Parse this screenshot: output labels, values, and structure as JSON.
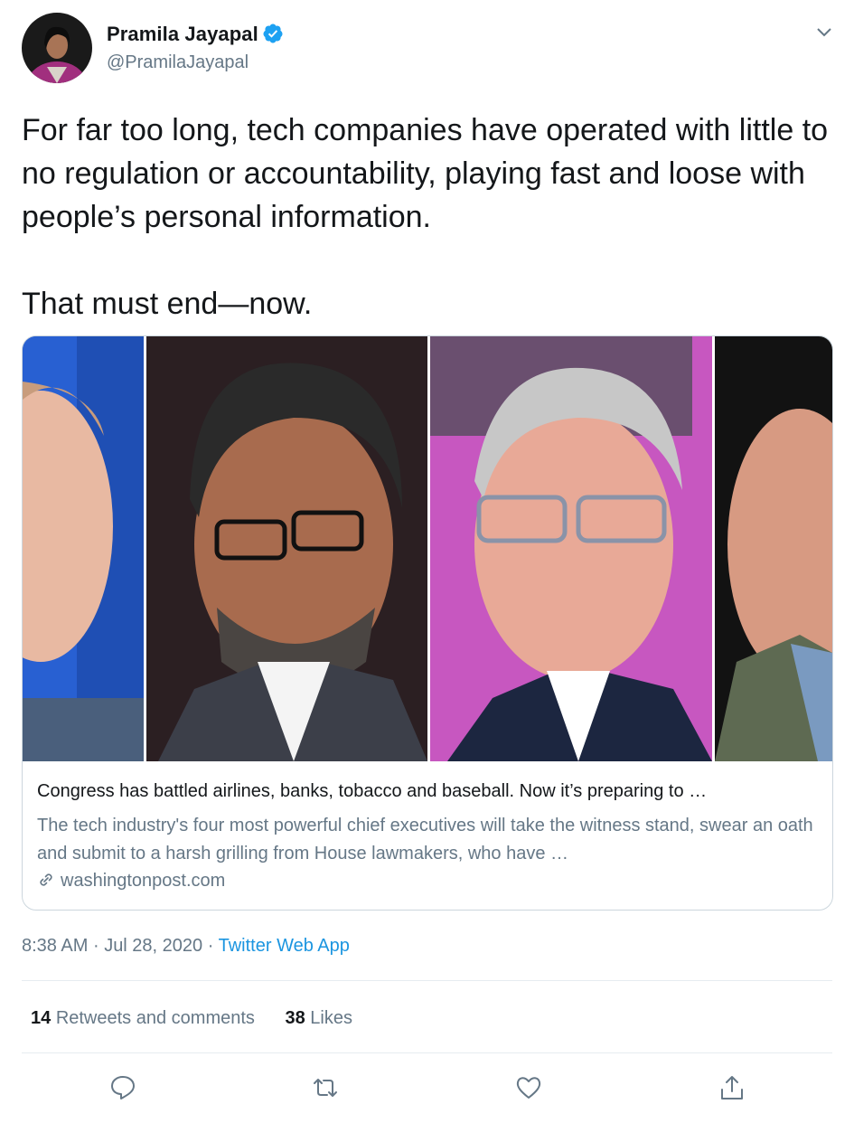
{
  "author": {
    "name": "Pramila Jayapal",
    "handle": "@PramilaJayapal",
    "verified": true,
    "avatar_icon": "profile-photo"
  },
  "tweet": {
    "text": "For far too long, tech companies have operated with little to no regulation or accountability, playing fast and loose with people’s personal information.\n\nThat must end—now."
  },
  "card": {
    "image_alt": "tech-ceo-portraits",
    "title": "Congress has battled airlines, banks, tobacco and baseball. Now it’s preparing to …",
    "description": "The tech industry's four most powerful chief executives will take the witness stand, swear an oath and submit to a harsh grilling from House lawmakers, who have …",
    "domain": "washingtonpost.com"
  },
  "meta": {
    "time": "8:38 AM",
    "date": "Jul 28, 2020",
    "separator": "·",
    "source": "Twitter Web App"
  },
  "stats": {
    "retweets_count": "14",
    "retweets_label": "Retweets and comments",
    "likes_count": "38",
    "likes_label": "Likes"
  },
  "colors": {
    "link": "#1b95e0",
    "secondary_text": "#657786",
    "verified": "#1da1f2"
  }
}
